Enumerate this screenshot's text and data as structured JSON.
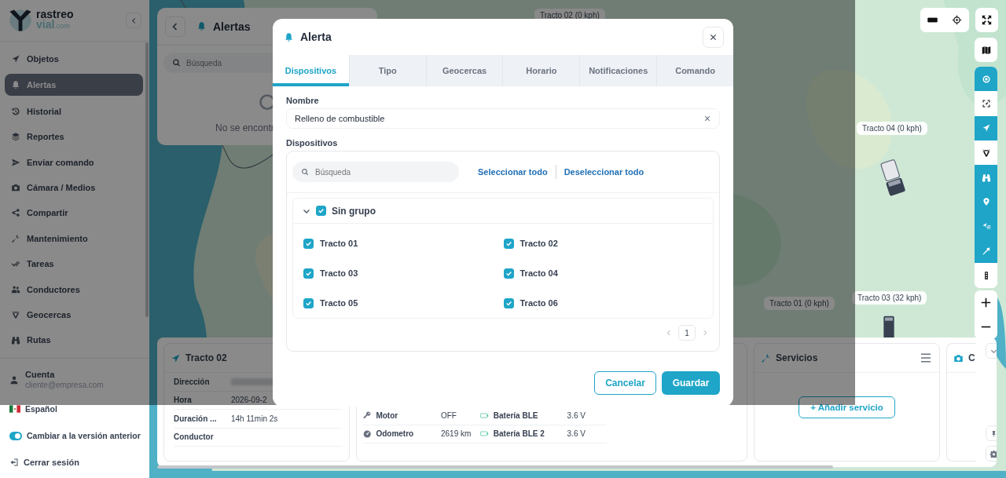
{
  "sidebar": {
    "brand": {
      "name": "rastreo",
      "sub": "vial",
      "suffix": ".com"
    },
    "items": [
      {
        "label": "Objetos",
        "selected": false
      },
      {
        "label": "Alertas",
        "selected": true
      },
      {
        "label": "Historial",
        "selected": false
      },
      {
        "label": "Reportes",
        "selected": false
      },
      {
        "label": "Enviar comando",
        "selected": false
      },
      {
        "label": "Cámara / Medios",
        "selected": false
      },
      {
        "label": "Compartir",
        "selected": false
      },
      {
        "label": "Mantenimiento",
        "selected": false
      },
      {
        "label": "Tareas",
        "selected": false
      },
      {
        "label": "Conductores",
        "selected": false
      },
      {
        "label": "Geocercas",
        "selected": false
      },
      {
        "label": "Rutas",
        "selected": false
      }
    ],
    "account": {
      "label": "Cuenta",
      "email": "cliente@empresa.com"
    },
    "language": "Español",
    "legacy_toggle": {
      "label": "Cambiar a la versión anterior",
      "on": true
    },
    "logout": "Cerrar sesión"
  },
  "alerts_panel": {
    "title": "Alertas",
    "search_placeholder": "Búsqueda",
    "empty_text": "No se encontr"
  },
  "map": {
    "markers": [
      {
        "label": "Tracto 02 (0 kph)"
      },
      {
        "label": "Tracto 04 (0 kph)"
      },
      {
        "label": "Tracto 01 (0 kph)"
      },
      {
        "label": "Tracto 03 (32 kph)"
      }
    ],
    "layer_buttons": [
      {
        "selected": true
      },
      {
        "selected": false
      },
      {
        "selected": true
      },
      {
        "selected": false
      },
      {
        "selected": true
      },
      {
        "selected": true
      },
      {
        "selected": true
      },
      {
        "selected": true
      },
      {
        "selected": false
      }
    ]
  },
  "vehicle_card": {
    "title": "Tracto 02",
    "rows": [
      {
        "label": "Dirección",
        "redacted": true
      },
      {
        "label": "Hora",
        "value": "2026-09-2"
      },
      {
        "label": "Duración ...",
        "value": "14h 11min 2s"
      },
      {
        "label": "Conductor"
      }
    ]
  },
  "sensors": [
    {
      "label": "Motor",
      "value": "OFF",
      "battery_label": "Batería BLE",
      "battery_value": "3.6 V"
    },
    {
      "label": "Odometro",
      "value": "2619 km",
      "battery_label": "Batería BLE 2",
      "battery_value": "3.6 V"
    }
  ],
  "services_card": {
    "title": "Servicios",
    "add_button": "+ Añadir servicio"
  },
  "camera_card": {
    "title": "C"
  },
  "modal": {
    "title": "Alerta",
    "tabs": [
      {
        "label": "Dispositivos",
        "selected": true
      },
      {
        "label": "Tipo",
        "selected": false
      },
      {
        "label": "Geocercas",
        "selected": false
      },
      {
        "label": "Horario",
        "selected": false
      },
      {
        "label": "Notificaciones",
        "selected": false
      },
      {
        "label": "Comando",
        "selected": false
      }
    ],
    "name_label": "Nombre",
    "name_value": "Relleno de combustible",
    "devices_label": "Dispositivos",
    "search_placeholder": "Búsqueda",
    "select_all": "Seleccionar todo",
    "deselect_all": "Deseleccionar todo",
    "group": {
      "name": "Sin grupo",
      "expanded": true,
      "checked": true,
      "devices": [
        {
          "name": "Tracto 01",
          "checked": true
        },
        {
          "name": "Tracto 02",
          "checked": true
        },
        {
          "name": "Tracto 03",
          "checked": true
        },
        {
          "name": "Tracto 04",
          "checked": true
        },
        {
          "name": "Tracto 05",
          "checked": true
        },
        {
          "name": "Tracto 06",
          "checked": true
        }
      ]
    },
    "page": "1",
    "cancel": "Cancelar",
    "save": "Guardar"
  }
}
